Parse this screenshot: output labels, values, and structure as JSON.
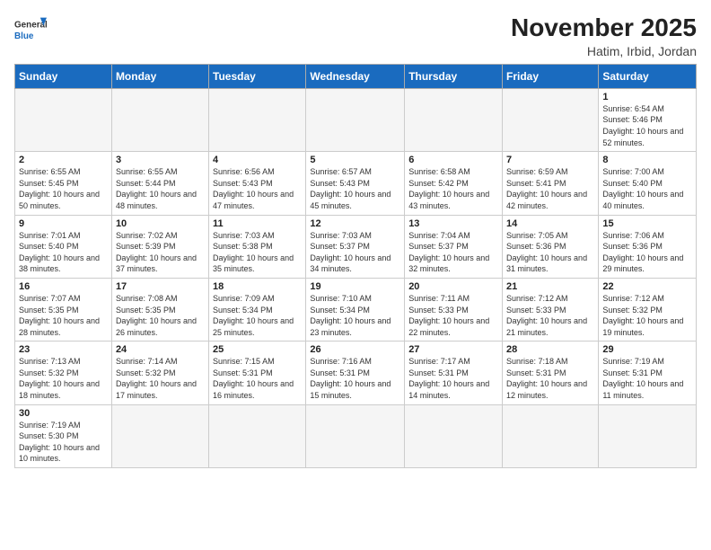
{
  "header": {
    "logo_general": "General",
    "logo_blue": "Blue",
    "month_year": "November 2025",
    "location": "Hatim, Irbid, Jordan"
  },
  "days_of_week": [
    "Sunday",
    "Monday",
    "Tuesday",
    "Wednesday",
    "Thursday",
    "Friday",
    "Saturday"
  ],
  "weeks": [
    [
      {
        "day": "",
        "info": ""
      },
      {
        "day": "",
        "info": ""
      },
      {
        "day": "",
        "info": ""
      },
      {
        "day": "",
        "info": ""
      },
      {
        "day": "",
        "info": ""
      },
      {
        "day": "",
        "info": ""
      },
      {
        "day": "1",
        "info": "Sunrise: 6:54 AM\nSunset: 5:46 PM\nDaylight: 10 hours\nand 52 minutes."
      }
    ],
    [
      {
        "day": "2",
        "info": "Sunrise: 6:55 AM\nSunset: 5:45 PM\nDaylight: 10 hours\nand 50 minutes."
      },
      {
        "day": "3",
        "info": "Sunrise: 6:55 AM\nSunset: 5:44 PM\nDaylight: 10 hours\nand 48 minutes."
      },
      {
        "day": "4",
        "info": "Sunrise: 6:56 AM\nSunset: 5:43 PM\nDaylight: 10 hours\nand 47 minutes."
      },
      {
        "day": "5",
        "info": "Sunrise: 6:57 AM\nSunset: 5:43 PM\nDaylight: 10 hours\nand 45 minutes."
      },
      {
        "day": "6",
        "info": "Sunrise: 6:58 AM\nSunset: 5:42 PM\nDaylight: 10 hours\nand 43 minutes."
      },
      {
        "day": "7",
        "info": "Sunrise: 6:59 AM\nSunset: 5:41 PM\nDaylight: 10 hours\nand 42 minutes."
      },
      {
        "day": "8",
        "info": "Sunrise: 7:00 AM\nSunset: 5:40 PM\nDaylight: 10 hours\nand 40 minutes."
      }
    ],
    [
      {
        "day": "9",
        "info": "Sunrise: 7:01 AM\nSunset: 5:40 PM\nDaylight: 10 hours\nand 38 minutes."
      },
      {
        "day": "10",
        "info": "Sunrise: 7:02 AM\nSunset: 5:39 PM\nDaylight: 10 hours\nand 37 minutes."
      },
      {
        "day": "11",
        "info": "Sunrise: 7:03 AM\nSunset: 5:38 PM\nDaylight: 10 hours\nand 35 minutes."
      },
      {
        "day": "12",
        "info": "Sunrise: 7:03 AM\nSunset: 5:37 PM\nDaylight: 10 hours\nand 34 minutes."
      },
      {
        "day": "13",
        "info": "Sunrise: 7:04 AM\nSunset: 5:37 PM\nDaylight: 10 hours\nand 32 minutes."
      },
      {
        "day": "14",
        "info": "Sunrise: 7:05 AM\nSunset: 5:36 PM\nDaylight: 10 hours\nand 31 minutes."
      },
      {
        "day": "15",
        "info": "Sunrise: 7:06 AM\nSunset: 5:36 PM\nDaylight: 10 hours\nand 29 minutes."
      }
    ],
    [
      {
        "day": "16",
        "info": "Sunrise: 7:07 AM\nSunset: 5:35 PM\nDaylight: 10 hours\nand 28 minutes."
      },
      {
        "day": "17",
        "info": "Sunrise: 7:08 AM\nSunset: 5:35 PM\nDaylight: 10 hours\nand 26 minutes."
      },
      {
        "day": "18",
        "info": "Sunrise: 7:09 AM\nSunset: 5:34 PM\nDaylight: 10 hours\nand 25 minutes."
      },
      {
        "day": "19",
        "info": "Sunrise: 7:10 AM\nSunset: 5:34 PM\nDaylight: 10 hours\nand 23 minutes."
      },
      {
        "day": "20",
        "info": "Sunrise: 7:11 AM\nSunset: 5:33 PM\nDaylight: 10 hours\nand 22 minutes."
      },
      {
        "day": "21",
        "info": "Sunrise: 7:12 AM\nSunset: 5:33 PM\nDaylight: 10 hours\nand 21 minutes."
      },
      {
        "day": "22",
        "info": "Sunrise: 7:12 AM\nSunset: 5:32 PM\nDaylight: 10 hours\nand 19 minutes."
      }
    ],
    [
      {
        "day": "23",
        "info": "Sunrise: 7:13 AM\nSunset: 5:32 PM\nDaylight: 10 hours\nand 18 minutes."
      },
      {
        "day": "24",
        "info": "Sunrise: 7:14 AM\nSunset: 5:32 PM\nDaylight: 10 hours\nand 17 minutes."
      },
      {
        "day": "25",
        "info": "Sunrise: 7:15 AM\nSunset: 5:31 PM\nDaylight: 10 hours\nand 16 minutes."
      },
      {
        "day": "26",
        "info": "Sunrise: 7:16 AM\nSunset: 5:31 PM\nDaylight: 10 hours\nand 15 minutes."
      },
      {
        "day": "27",
        "info": "Sunrise: 7:17 AM\nSunset: 5:31 PM\nDaylight: 10 hours\nand 14 minutes."
      },
      {
        "day": "28",
        "info": "Sunrise: 7:18 AM\nSunset: 5:31 PM\nDaylight: 10 hours\nand 12 minutes."
      },
      {
        "day": "29",
        "info": "Sunrise: 7:19 AM\nSunset: 5:31 PM\nDaylight: 10 hours\nand 11 minutes."
      }
    ],
    [
      {
        "day": "30",
        "info": "Sunrise: 7:19 AM\nSunset: 5:30 PM\nDaylight: 10 hours\nand 10 minutes."
      },
      {
        "day": "",
        "info": ""
      },
      {
        "day": "",
        "info": ""
      },
      {
        "day": "",
        "info": ""
      },
      {
        "day": "",
        "info": ""
      },
      {
        "day": "",
        "info": ""
      },
      {
        "day": "",
        "info": ""
      }
    ]
  ]
}
